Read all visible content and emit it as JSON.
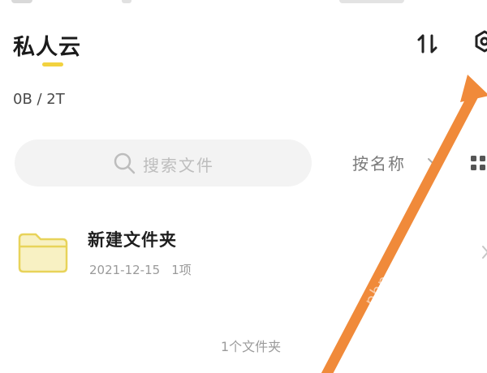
{
  "header": {
    "title": "私人云",
    "sort_icon": "sort-arrows-icon",
    "settings_icon": "gear-icon"
  },
  "storage": {
    "usage": "0B / 2T"
  },
  "search": {
    "placeholder": "搜索文件"
  },
  "toolbar": {
    "sort_label": "按名称",
    "view_icon": "grid-icon"
  },
  "files": [
    {
      "name": "新建文件夹",
      "date": "2021-12-15",
      "items": "1项",
      "icon": "folder-icon"
    }
  ],
  "footer": {
    "count": "1个文件夹"
  },
  "annotation": {
    "color": "#f08a3a",
    "watermark": "php"
  },
  "colors": {
    "accent": "#f2d23f",
    "folder_fill": "#f8f1c3",
    "folder_stroke": "#e8d35a"
  }
}
